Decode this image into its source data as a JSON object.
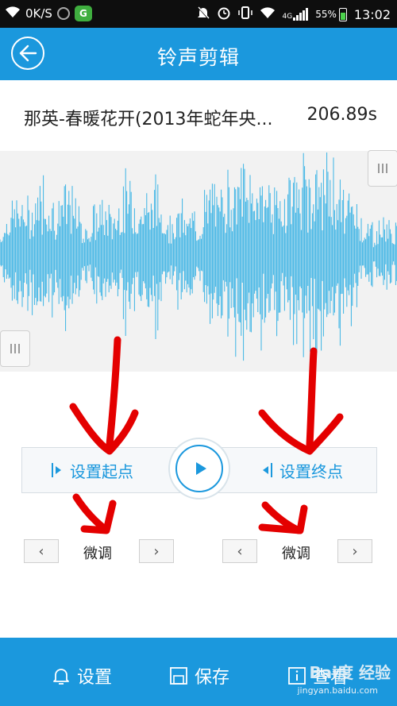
{
  "status_bar": {
    "speed": "0K/S",
    "app_badge": "G",
    "network": "4G",
    "battery": "55%",
    "time": "13:02"
  },
  "header": {
    "title": "铃声剪辑"
  },
  "song": {
    "title": "那英-春暖花开(2013年蛇年央...",
    "duration": "206.89s"
  },
  "controls": {
    "set_start_label": "设置起点",
    "set_end_label": "设置终点",
    "fine_tune_left_label": "微调",
    "fine_tune_right_label": "微调",
    "prev_glyph": "‹",
    "next_glyph": "›"
  },
  "bottom_bar": {
    "settings_label": "设置",
    "save_label": "保存",
    "view_label": "查看",
    "watermark_text": "Bai度 经验",
    "watermark_url": "jingyan.baidu.com"
  },
  "colors": {
    "accent": "#1b98dd",
    "waveform": "#3bb4e5",
    "annotation": "#e40000"
  }
}
